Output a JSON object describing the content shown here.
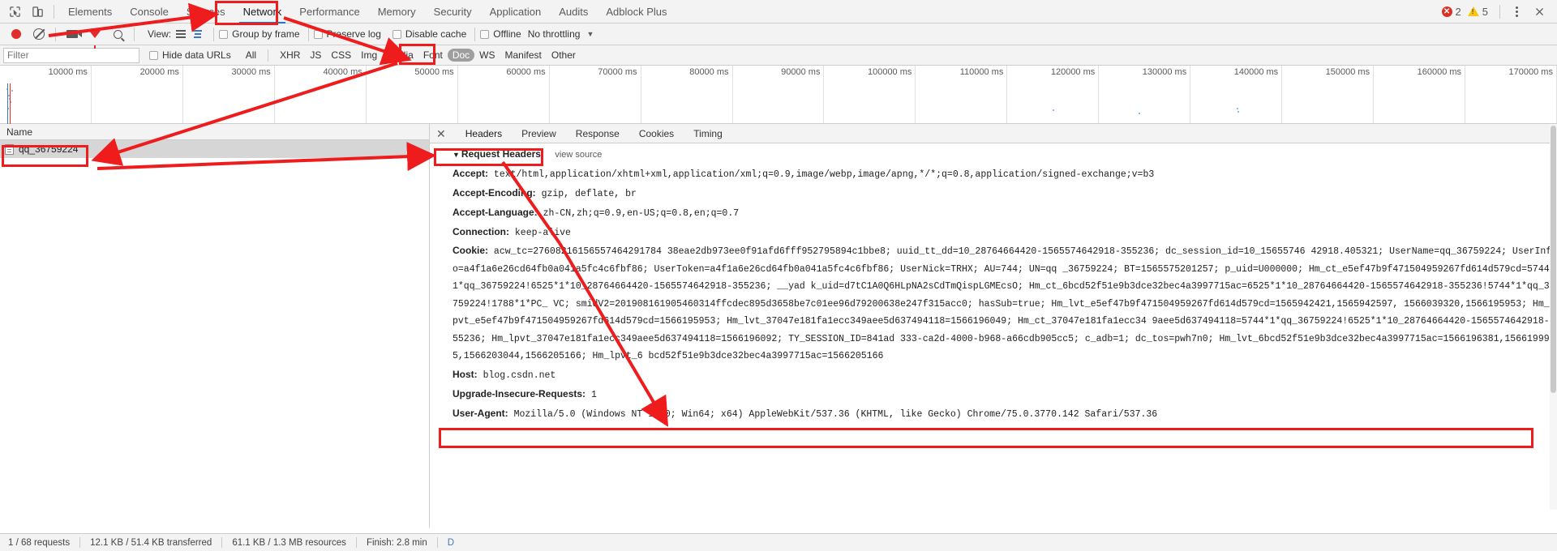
{
  "window": {
    "tabs": [
      {
        "label": "Elements",
        "active": false
      },
      {
        "label": "Console",
        "active": false
      },
      {
        "label": "Sources",
        "active": false
      },
      {
        "label": "Network",
        "active": true
      },
      {
        "label": "Performance",
        "active": false
      },
      {
        "label": "Memory",
        "active": false
      },
      {
        "label": "Security",
        "active": false
      },
      {
        "label": "Application",
        "active": false
      },
      {
        "label": "Audits",
        "active": false
      },
      {
        "label": "Adblock Plus",
        "active": false
      }
    ],
    "error_count": "2",
    "warning_count": "5",
    "error_color": "#d93025",
    "warning_color": "#f5c518",
    "accent_color": "#1a73e8"
  },
  "toolbar": {
    "view_label": "View:",
    "group_by_frame": "Group by frame",
    "preserve_log": "Preserve log",
    "disable_cache": "Disable cache",
    "offline": "Offline",
    "throttling": "No throttling"
  },
  "filterbar": {
    "placeholder": "Filter",
    "value": "",
    "hide_data_urls": "Hide data URLs",
    "types": [
      {
        "label": "All",
        "active": false
      },
      {
        "label": "XHR",
        "active": false
      },
      {
        "label": "JS",
        "active": false
      },
      {
        "label": "CSS",
        "active": false
      },
      {
        "label": "Img",
        "active": false
      },
      {
        "label": "Media",
        "active": false
      },
      {
        "label": "Font",
        "active": false
      },
      {
        "label": "Doc",
        "active": true
      },
      {
        "label": "WS",
        "active": false
      },
      {
        "label": "Manifest",
        "active": false
      },
      {
        "label": "Other",
        "active": false
      }
    ]
  },
  "overview": {
    "ticks": [
      "10000 ms",
      "20000 ms",
      "30000 ms",
      "40000 ms",
      "50000 ms",
      "60000 ms",
      "70000 ms",
      "80000 ms",
      "90000 ms",
      "100000 ms",
      "110000 ms",
      "120000 ms",
      "130000 ms",
      "140000 ms",
      "150000 ms",
      "160000 ms",
      "170000 ms"
    ]
  },
  "requests": {
    "column_header": "Name",
    "rows": [
      {
        "name": "qq_36759224",
        "type_icon": "document-icon",
        "selected": true
      }
    ]
  },
  "detail": {
    "tabs": [
      {
        "label": "Headers",
        "active": true
      },
      {
        "label": "Preview",
        "active": false
      },
      {
        "label": "Response",
        "active": false
      },
      {
        "label": "Cookies",
        "active": false
      },
      {
        "label": "Timing",
        "active": false
      }
    ],
    "section_title": "Request Headers",
    "view_source": "view source",
    "headers": [
      {
        "name": "Accept:",
        "value": "text/html,application/xhtml+xml,application/xml;q=0.9,image/webp,image/apng,*/*;q=0.8,application/signed-exchange;v=b3"
      },
      {
        "name": "Accept-Encoding:",
        "value": "gzip, deflate, br"
      },
      {
        "name": "Accept-Language:",
        "value": "zh-CN,zh;q=0.9,en-US;q=0.8,en;q=0.7"
      },
      {
        "name": "Connection:",
        "value": "keep-alive"
      },
      {
        "name": "Cookie:",
        "value": "acw_tc=27608216156557464291784 38eae2db973ee0f91afd6fff952795894c1bbe8; uuid_tt_dd=10_28764664420-1565574642918-355236; dc_session_id=10_15655746 42918.405321; UserName=qq_36759224; UserInfo=a4f1a6e26cd64fb0a041a5fc4c6fbf86; UserToken=a4f1a6e26cd64fb0a041a5fc4c6fbf86; UserNick=TRHX; AU=744; UN=qq _36759224; BT=1565575201257; p_uid=U000000; Hm_ct_e5ef47b9f471504959267fd614d579cd=5744*1*qq_36759224!6525*1*10_28764664420-1565574642918-355236; __yad k_uid=d7tC1A0Q6HLpNA2sCdTmQispLGMEcsO; Hm_ct_6bcd52f51e9b3dce32bec4a3997715ac=6525*1*10_28764664420-1565574642918-355236!5744*1*qq_36759224!1788*1*PC_ VC; smidV2=201908161905460314ffcdec895d3658be7c01ee96d79200638e247f315acc0; hasSub=true; Hm_lvt_e5ef47b9f471504959267fd614d579cd=1565942421,1565942597, 1566039320,1566195953; Hm_lpvt_e5ef47b9f471504959267fd614d579cd=1566195953; Hm_lvt_37047e181fa1ecc349aee5d637494118=1566196049; Hm_ct_37047e181fa1ecc34 9aee5d637494118=5744*1*qq_36759224!6525*1*10_28764664420-1565574642918-355236; Hm_lpvt_37047e181fa1ecc349aee5d637494118=1566196092; TY_SESSION_ID=841ad 333-ca2d-4000-b968-a66cdb905cc5; c_adb=1; dc_tos=pwh7n0; Hm_lvt_6bcd52f51e9b3dce32bec4a3997715ac=1566196381,1566199915,1566203044,1566205166; Hm_lpvt_6 bcd52f51e9b3dce32bec4a3997715ac=1566205166"
      },
      {
        "name": "Host:",
        "value": "blog.csdn.net"
      },
      {
        "name": "Upgrade-Insecure-Requests:",
        "value": "1"
      },
      {
        "name": "User-Agent:",
        "value": "Mozilla/5.0 (Windows NT 10.0; Win64; x64) AppleWebKit/537.36 (KHTML, like Gecko) Chrome/75.0.3770.142 Safari/537.36"
      }
    ]
  },
  "statusbar": {
    "requests": "1 / 68 requests",
    "transferred": "12.1 KB / 51.4 KB transferred",
    "resources": "61.1 KB / 1.3 MB resources",
    "finish": "Finish: 2.8 min",
    "partial": "D"
  },
  "annotation": {
    "color": "#ee1c1c"
  }
}
